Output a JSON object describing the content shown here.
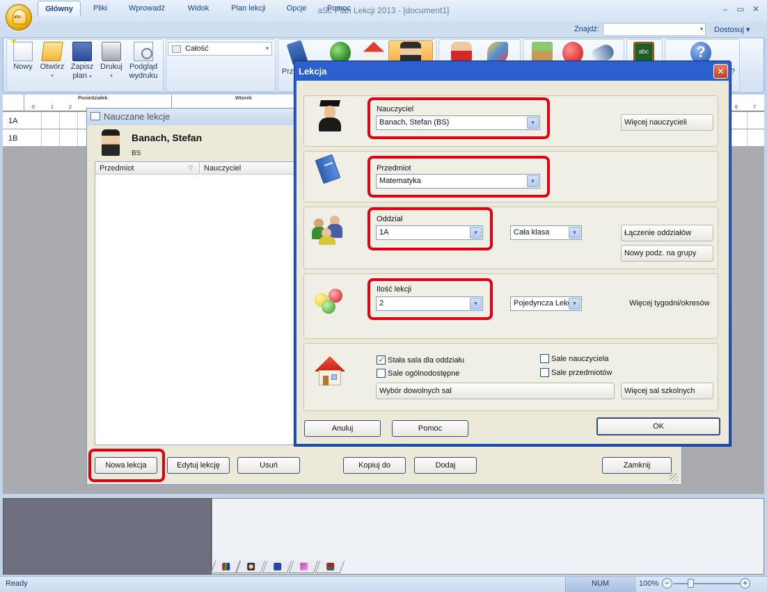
{
  "app": {
    "title": "aSc Plan Lekcji 2013  - [document1]",
    "orb_label": "aSc",
    "window_controls": {
      "minimize": "–",
      "restore": "▭",
      "close": "✕"
    }
  },
  "ribbon": {
    "tabs": [
      "Główny",
      "Pliki",
      "Wprowadź",
      "Widok",
      "Plan lekcji",
      "Opcje",
      "Pomoc"
    ],
    "active_tab": "Główny",
    "find_label": "Znajdź:",
    "find_value": "",
    "customize": "Dostosuj ▾",
    "buttons": {
      "new": "Nowy",
      "open": "Otwórz",
      "save_line1": "Zapisz",
      "save_line2": "plan",
      "print": "Drukuj",
      "preview_line1": "Podgląd",
      "preview_line2": "wydruku",
      "cut_left": "Prz",
      "cut_right": "?"
    },
    "scope_select": "Całość",
    "icons": [
      "new-document-icon",
      "open-folder-icon",
      "save-disk-icon",
      "printer-icon",
      "print-preview-icon",
      "book-icon",
      "class-group-icon",
      "classroom-house-icon",
      "teacher-icon",
      "student-icon",
      "subject-shapes-icon",
      "inbox-icon",
      "red-ball-icon",
      "flashlight-icon",
      "chalkboard-icon",
      "help-icon"
    ],
    "chalkboard_text": "abc"
  },
  "timetable": {
    "days": [
      "Poniedziałek",
      "Wtorek"
    ],
    "period_labels": [
      "0",
      "1",
      "2"
    ],
    "right_period_labels": [
      "6",
      "7"
    ],
    "rows": [
      "1A",
      "1B"
    ]
  },
  "bottom_pane": {
    "tab_icons": [
      "chart-icon",
      "teacher-tab-icon",
      "cap-tab-icon",
      "subject-tab-icon",
      "room-tab-icon"
    ]
  },
  "status": {
    "text": "Ready",
    "num": "NUM",
    "zoom": "100%",
    "zoom_minus": "−",
    "zoom_plus": "+"
  },
  "taught_lessons": {
    "title": "Nauczane lekcje",
    "teacher_name": "Banach, Stefan",
    "teacher_abbr": "BS",
    "columns": [
      "Przedmiot",
      "Nauczyciel"
    ],
    "sort_glyph": "▽",
    "buttons": {
      "new_lesson": "Nowa lekcja",
      "edit_lesson": "Edytuj lekcję",
      "delete": "Usuń",
      "copy_to": "Kopiuj do",
      "add": "Dodaj",
      "close": "Zamknij"
    }
  },
  "lesson_dialog": {
    "title": "Lekcja",
    "close_glyph": "✕",
    "teacher": {
      "label": "Nauczyciel",
      "value": "Banach, Stefan (BS)",
      "more_button": "Więcej nauczycieli"
    },
    "subject": {
      "label": "Przedmiot",
      "value": "Matematyka"
    },
    "class": {
      "label": "Oddział",
      "value": "1A",
      "group_value": "Cała klasa",
      "join_button": "Łączenie oddziałów",
      "new_division_button": "Nowy podz. na grupy"
    },
    "count": {
      "label": "Ilość lekcji",
      "value": "2",
      "length_value": "Pojedyncza Lekc",
      "more_weeks": "Więcej tygodni/okresów"
    },
    "rooms": {
      "fixed_room": {
        "label": "Stała sala dla oddziału",
        "checked": true
      },
      "teacher_rooms": {
        "label": "Sale nauczyciela",
        "checked": false
      },
      "public_rooms": {
        "label": "Sale ogólnodostępne",
        "checked": false
      },
      "subject_rooms": {
        "label": "Sale przedmiotów",
        "checked": false
      },
      "choose_any": "Wybór dowolnych sal",
      "more_rooms": "Więcej sal szkolnych"
    },
    "buttons": {
      "cancel": "Anuluj",
      "help": "Pomoc",
      "ok": "OK"
    }
  },
  "highlight_color": "#e00012",
  "dropdown_glyph": "▾"
}
